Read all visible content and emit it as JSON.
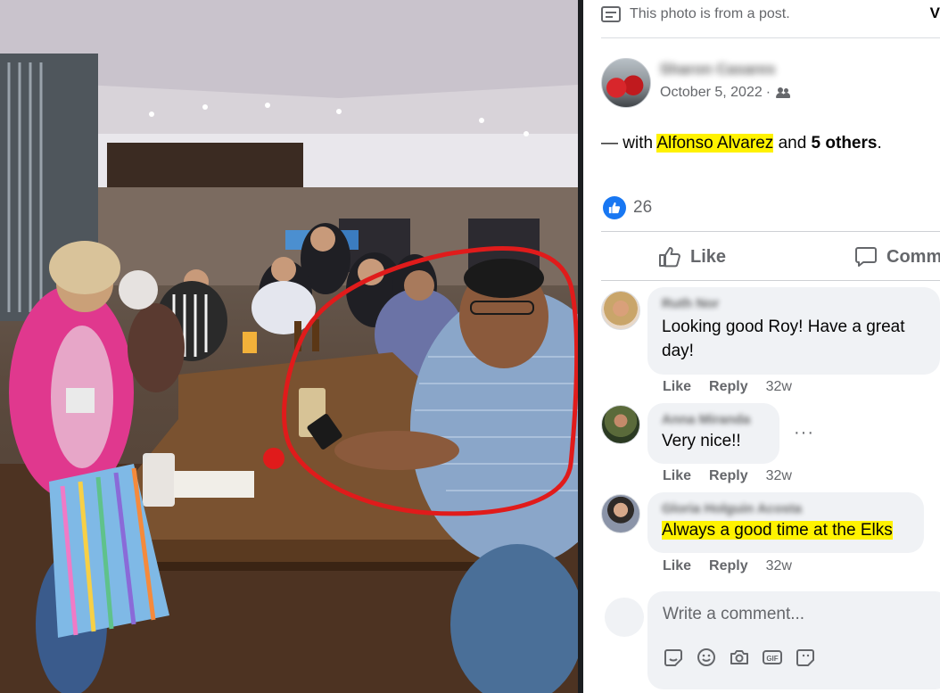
{
  "post_note": "This photo is from a post.",
  "view_cut": "V",
  "author": "Sharon Casares",
  "date": "October 5, 2022",
  "date_sep": "·",
  "with_prefix": "— with",
  "tagged_person": "Alfonso Alvarez",
  "with_and": "and",
  "others": "5 others",
  "with_suffix": ".",
  "reaction_count": "26",
  "actions": {
    "like": "Like",
    "comment": "Comm"
  },
  "comments": [
    {
      "name": "Ruth Nor",
      "text": "Looking good Roy! Have a great day!",
      "like": "Like",
      "reply": "Reply",
      "time": "32w"
    },
    {
      "name": "Anna Miranda",
      "text": "Very nice!!",
      "like": "Like",
      "reply": "Reply",
      "time": "32w",
      "more": "···"
    },
    {
      "name": "Gloria Holguin Acosta",
      "text": "Always a good time at the Elks",
      "like": "Like",
      "reply": "Reply",
      "time": "32w"
    }
  ],
  "write_comment": {
    "placeholder": "Write a comment..."
  },
  "icons": [
    "sticker-icon",
    "emoji-icon",
    "camera-icon",
    "gif-icon",
    "avatar-sticker-icon"
  ],
  "colors": {
    "highlight": "#fff200",
    "like_blue": "#1877f2",
    "circle_red": "#e01b1b"
  }
}
